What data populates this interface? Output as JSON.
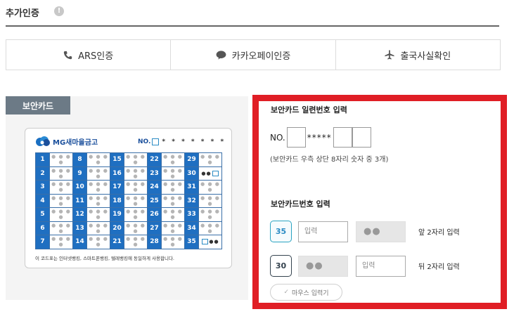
{
  "header": {
    "title": "추가인증",
    "info_icon": "info-icon"
  },
  "tabs": [
    {
      "label": "ARS인증",
      "icon": "phone-icon"
    },
    {
      "label": "카카오페이인증",
      "icon": "chat-bubble-icon"
    },
    {
      "label": "출국사실확인",
      "icon": "airplane-icon"
    }
  ],
  "card_panel": {
    "tag": "보안카드",
    "brand": "MG새마을금고",
    "no_label": "NO.",
    "no_stars": "* * * * * * *",
    "dots": "● ● ● ●",
    "row30": "●●",
    "row35": "●●",
    "footer": "이 코드표는 인터넷뱅킹, 스마트폰뱅킹, 텔레뱅킹에 동일하게 사용합니다.",
    "columns": [
      [
        1,
        2,
        3,
        4,
        5,
        6,
        7
      ],
      [
        8,
        9,
        10,
        11,
        12,
        13,
        14
      ],
      [
        15,
        16,
        17,
        18,
        19,
        20,
        21
      ],
      [
        22,
        23,
        24,
        25,
        26,
        27,
        28
      ],
      [
        29,
        30,
        31,
        32,
        33,
        34,
        35
      ]
    ]
  },
  "serial": {
    "title": "보안카드 일련번호 입력",
    "no_label": "NO.",
    "stars": "*****",
    "hint": "(보안카드 우측 상단 8자리 숫자 중 3개)"
  },
  "pin": {
    "title": "보안카드번호 입력",
    "row1": {
      "position": "35",
      "placeholder": "입력",
      "masked": "●●",
      "note": "앞 2자리 입력"
    },
    "row2": {
      "position": "30",
      "placeholder": "입력",
      "masked": "●●",
      "note": "뒤 2자리 입력"
    },
    "mouse_button": "마우스 입력기"
  },
  "colors": {
    "highlight_border": "#e01e25",
    "card_blue": "#1f6fc1",
    "tag_bg": "#6c7a86"
  }
}
